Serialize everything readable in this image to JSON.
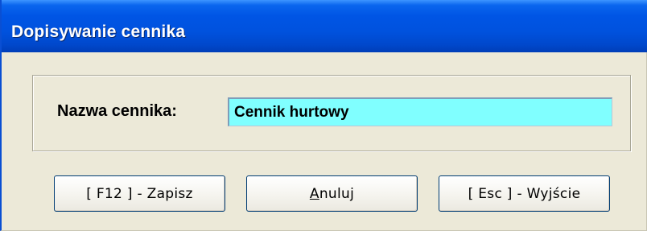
{
  "window": {
    "title": "Dopisywanie cennika"
  },
  "form": {
    "price_list_name_label": "Nazwa cennika:",
    "price_list_name_value": "Cennik hurtowy"
  },
  "buttons": {
    "save_label": "[ F12 ] - Zapisz",
    "cancel_label": "Anuluj",
    "exit_label": "[ Esc ] - Wyjście"
  },
  "colors": {
    "titlebar": "#0055e5",
    "window_background": "#ece9d8",
    "input_background": "#80ffff"
  }
}
